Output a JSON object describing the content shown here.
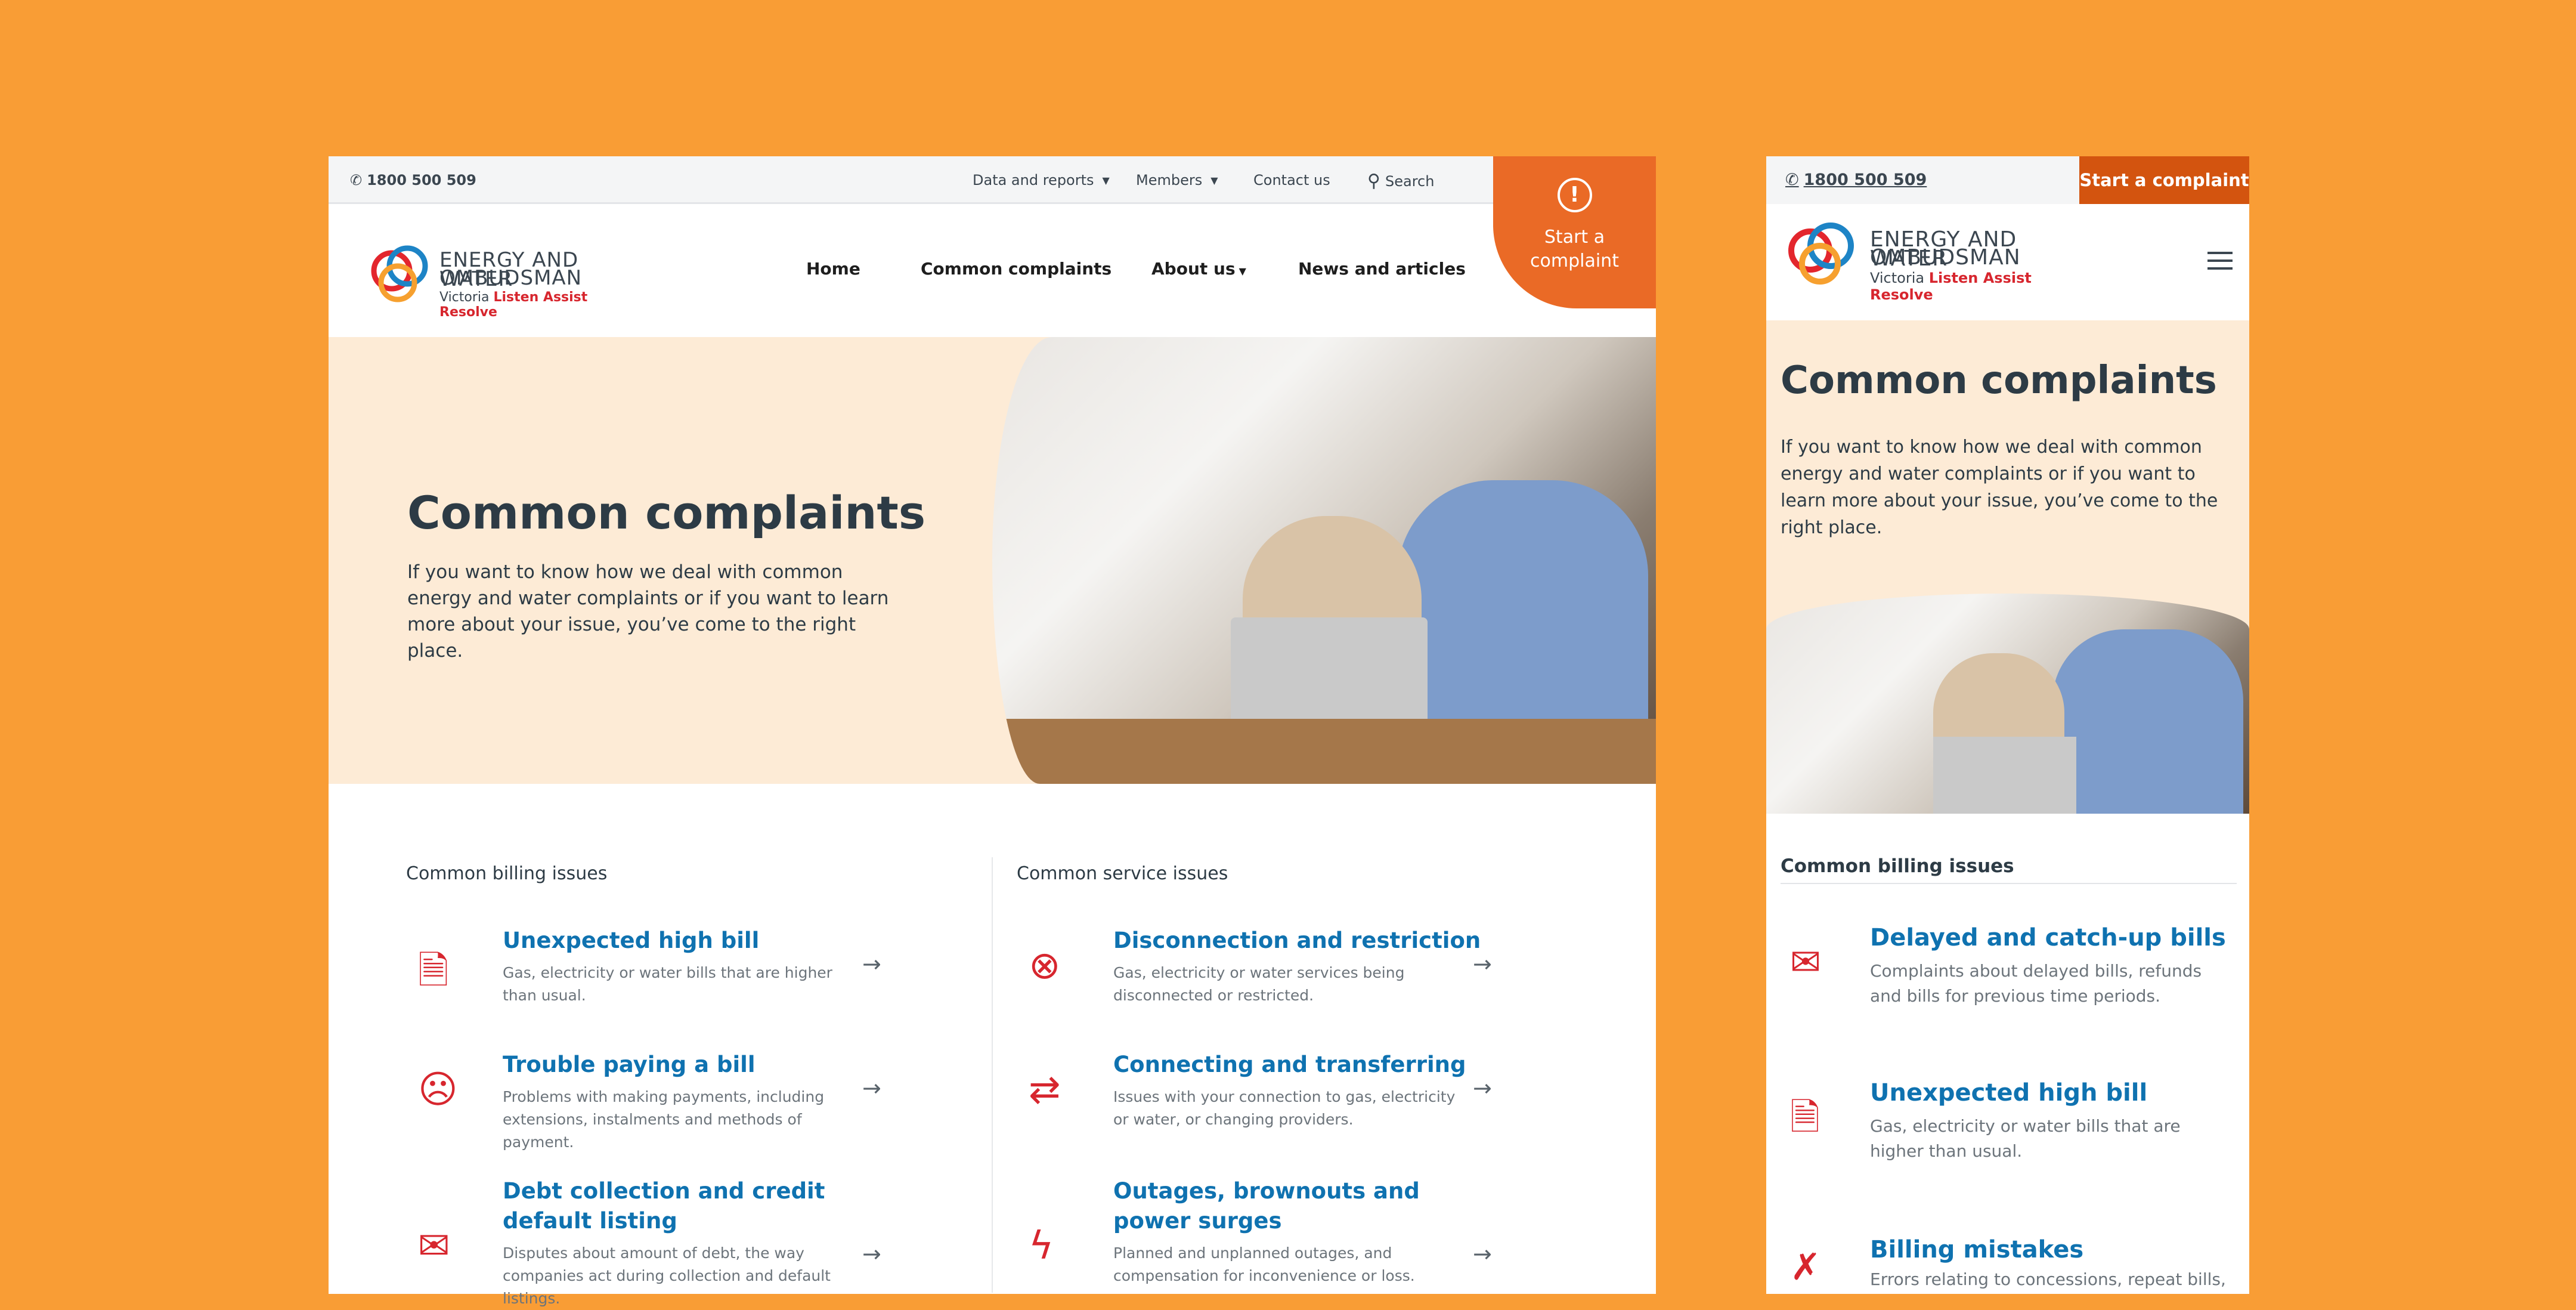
{
  "desktop": {
    "phone": "1800 500 509",
    "utility_nav": [
      {
        "label": "Data and reports",
        "dropdown": true
      },
      {
        "label": "Members",
        "dropdown": true
      },
      {
        "label": "Contact us",
        "dropdown": false
      },
      {
        "label": "Search",
        "icon": "search-icon"
      }
    ],
    "cta": {
      "line1": "Start a",
      "line2": "complaint",
      "icon": "alert-speech-bubble-icon"
    },
    "logo": {
      "line1": "ENERGY AND WATER",
      "line2": "OMBUDSMAN",
      "state": "Victoria",
      "tagline": "Listen Assist Resolve"
    },
    "main_nav": [
      {
        "label": "Home"
      },
      {
        "label": "Common complaints"
      },
      {
        "label": "About us",
        "dropdown": true
      },
      {
        "label": "News and articles"
      }
    ],
    "hero": {
      "title": "Common complaints",
      "text": "If you want to know how we deal with common energy and water complaints or if you want to learn more about your issue, you’ve come to the right place."
    },
    "billing": {
      "heading": "Common billing issues",
      "items": [
        {
          "title": "Unexpected high bill",
          "desc": "Gas, electricity or water bills that are higher than usual.",
          "icon": "bill-documents-icon"
        },
        {
          "title": "Trouble paying a bill",
          "desc": "Problems with making payments, including extensions, instalments and methods of payment.",
          "icon": "stressed-face-icon"
        },
        {
          "title": "Debt collection and credit default listing",
          "desc": "Disputes about amount of debt, the way companies act during collection and default listings.",
          "icon": "due-envelope-icon"
        }
      ]
    },
    "service": {
      "heading": "Common service issues",
      "items": [
        {
          "title": "Disconnection and restriction",
          "desc": "Gas, electricity or water services being disconnected or restricted.",
          "icon": "unplugged-icon"
        },
        {
          "title": "Connecting and transferring",
          "desc": "Issues with your connection to gas, electricity or water, or changing providers.",
          "icon": "transfer-arrows-icon"
        },
        {
          "title": "Outages, brownouts and power surges",
          "desc": "Planned and unplanned outages, and compensation for inconvenience or loss.",
          "icon": "lightbulb-bolt-icon"
        }
      ]
    }
  },
  "mobile": {
    "phone": "1800 500 509",
    "cta": "Start a complaint",
    "hero": {
      "title": "Common complaints",
      "text": "If you want to know how we deal with common energy and water complaints or if you want to learn more about your issue, you’ve come to the right place."
    },
    "billing": {
      "heading": "Common billing issues",
      "items": [
        {
          "title": "Delayed and catch-up bills",
          "desc": "Complaints about delayed bills, refunds and bills for previous time periods.",
          "icon": "dollar-envelope-icon"
        },
        {
          "title": "Unexpected high bill",
          "desc": "Gas, electricity or water bills that are higher than usual.",
          "icon": "bill-documents-icon"
        },
        {
          "title": "Billing mistakes",
          "desc": "Errors relating to concessions, repeat bills,",
          "icon": "bill-error-icon"
        }
      ]
    }
  },
  "colors": {
    "background": "#f99d35",
    "cta": "#ea6a26",
    "mobile_cta": "#d3540f",
    "link": "#0f72b0",
    "icon": "#d7262e",
    "hero_bg": "#fdebd6"
  }
}
